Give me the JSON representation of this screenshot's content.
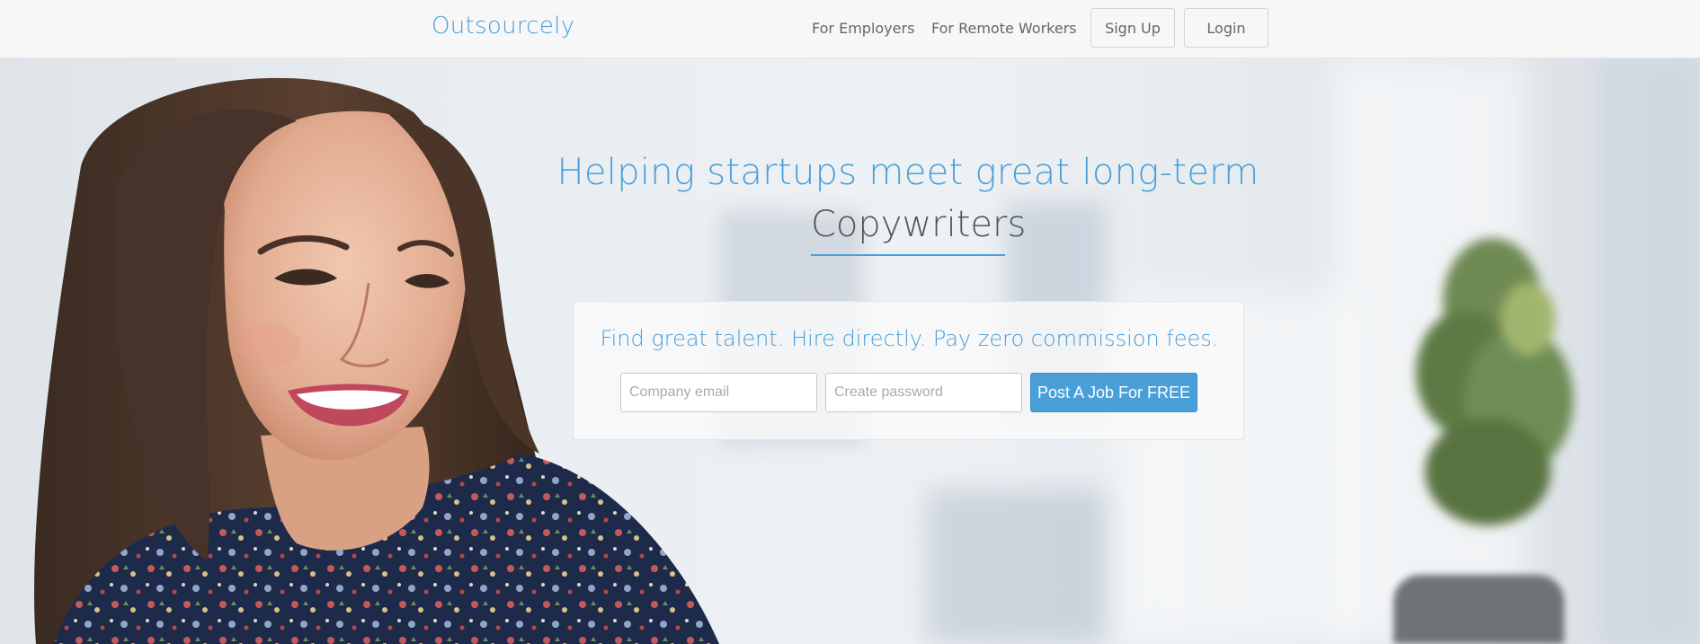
{
  "navbar": {
    "brand": "Outsourcely",
    "links": [
      {
        "label": "For Employers"
      },
      {
        "label": "For Remote Workers"
      }
    ],
    "signup_label": "Sign Up",
    "login_label": "Login"
  },
  "hero": {
    "headline": "Helping startups meet great long-term",
    "role": "Copywriters",
    "tagline": "Find great talent. Hire directly. Pay zero commission fees.",
    "email_placeholder": "Company email",
    "password_placeholder": "Create password",
    "cta_label": "Post A Job For FREE"
  },
  "colors": {
    "accent": "#4a9fd8",
    "nav_bg": "#f7f7f7"
  }
}
